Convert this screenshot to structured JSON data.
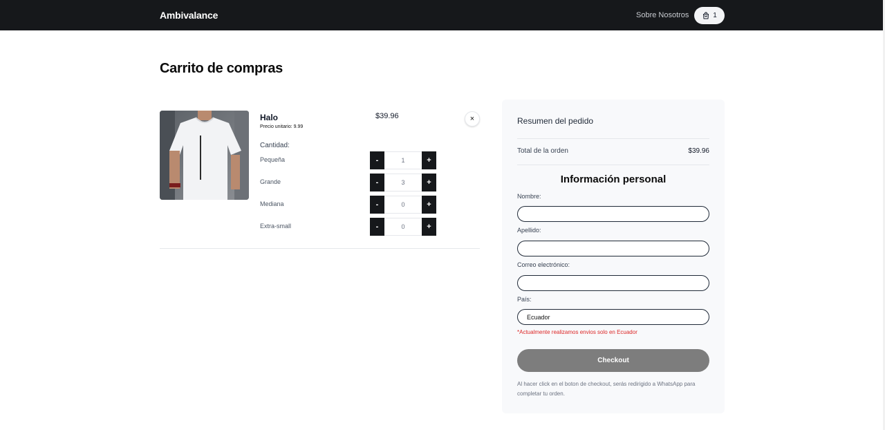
{
  "header": {
    "brand": "Ambivalance",
    "nav_link": "Sobre Nosotros",
    "cart_icon": "shopping-bag-icon",
    "cart_count": "1"
  },
  "page": {
    "title": "Carrito de compras"
  },
  "cart": {
    "item": {
      "name": "Halo",
      "unit_price": "Precio unitario: 9.99",
      "line_total": "$39.96",
      "remove_icon": "close-icon",
      "remove_label": "×",
      "quantity_label": "Cantidad:",
      "sizes": [
        {
          "label": "Pequeña",
          "value": "1"
        },
        {
          "label": "Grande",
          "value": "3"
        },
        {
          "label": "Mediana",
          "value": "0"
        },
        {
          "label": "Extra-small",
          "value": "0"
        }
      ],
      "minus_label": "-",
      "plus_label": "+"
    }
  },
  "summary": {
    "title": "Resumen del pedido",
    "total_label": "Total de la orden",
    "total_value": "$39.96",
    "personal_title": "Información personal",
    "fields": {
      "nombre_label": "Nombre:",
      "nombre_value": "",
      "apellido_label": "Apellido:",
      "apellido_value": "",
      "correo_label": "Correo electrónico:",
      "correo_value": "",
      "pais_label": "País:",
      "pais_value": "Ecuador"
    },
    "shipping_note": "*Actualmente realizamos envios solo en Ecuador",
    "checkout_label": "Checkout",
    "checkout_note": "Al hacer click en el boton de checkout, serás redirigido a WhatsApp para completar tu orden."
  },
  "colors": {
    "navbar": "#16181b",
    "checkout_button": "#7d7d7d",
    "note_red": "#dc2626",
    "panel_bg": "#f8f9fb"
  }
}
